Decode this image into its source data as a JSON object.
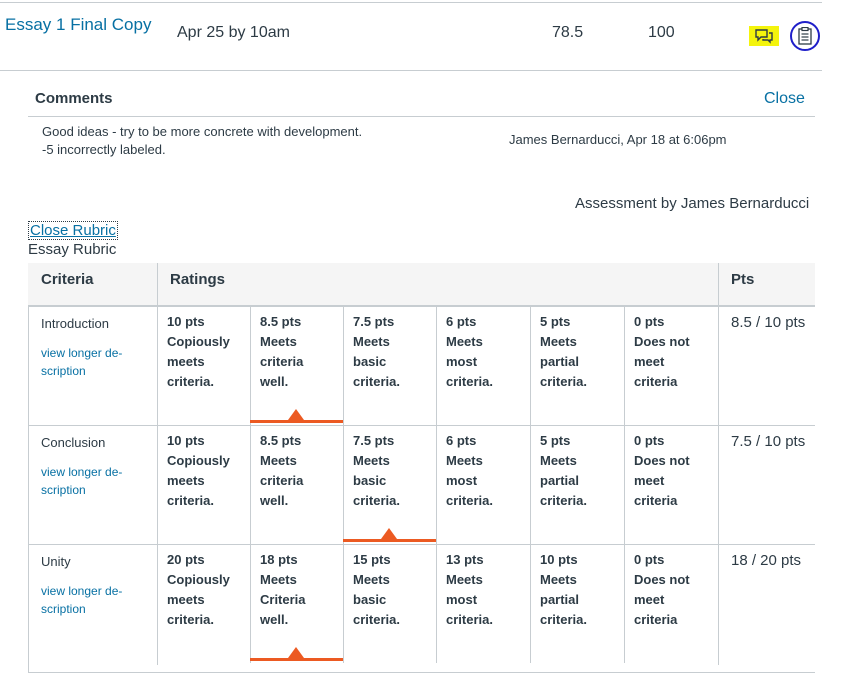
{
  "assignment": {
    "name": "Essay 1 Final Copy",
    "due": "Apr 25 by 10am",
    "score": "78.5",
    "points_possible": "100",
    "comment_icon": "comment-bubbles-icon",
    "rubric_icon": "rubric-clipboard-icon"
  },
  "comments": {
    "title": "Comments",
    "close_label": "Close",
    "lines": [
      "Good ideas - try to be more concrete with development.",
      "-5 incorrectly labeled."
    ],
    "author": "James Bernarducci, Apr 18 at 6:06pm"
  },
  "rubric": {
    "assessment_by": "Assessment by James Bernarducci",
    "close_label": "Close Rubric",
    "title": "Essay Rubric",
    "headers": {
      "criteria": "Criteria",
      "ratings": "Ratings",
      "pts": "Pts"
    },
    "highlight_color": "#ec5a22",
    "criteria": [
      {
        "name": "Introduction",
        "link": "view longer de-scription",
        "link_lines": [
          "view longer de-",
          "scription"
        ],
        "selected_index": 1,
        "score": "8.5 / 10 pts",
        "ratings": [
          {
            "pts": "10 pts",
            "desc": [
              "Copiously",
              "meets",
              "criteria."
            ]
          },
          {
            "pts": "8.5 pts",
            "desc": [
              "Meets",
              "criteria",
              "well."
            ]
          },
          {
            "pts": "7.5 pts",
            "desc": [
              "Meets",
              "basic",
              "criteria."
            ]
          },
          {
            "pts": "6 pts",
            "desc": [
              "Meets",
              "most",
              "criteria."
            ]
          },
          {
            "pts": "5 pts",
            "desc": [
              "Meets",
              "partial",
              "criteria."
            ]
          },
          {
            "pts": "0 pts",
            "desc": [
              "Does not",
              "meet",
              "criteria"
            ]
          }
        ]
      },
      {
        "name": "Conclusion",
        "link": "view longer de-scription",
        "link_lines": [
          "view longer de-",
          "scription"
        ],
        "selected_index": 2,
        "score": "7.5 / 10 pts",
        "ratings": [
          {
            "pts": "10 pts",
            "desc": [
              "Copiously",
              "meets",
              "criteria."
            ]
          },
          {
            "pts": "8.5 pts",
            "desc": [
              "Meets",
              "criteria",
              "well."
            ]
          },
          {
            "pts": "7.5 pts",
            "desc": [
              "Meets",
              "basic",
              "criteria."
            ]
          },
          {
            "pts": "6 pts",
            "desc": [
              "Meets",
              "most",
              "criteria."
            ]
          },
          {
            "pts": "5 pts",
            "desc": [
              "Meets",
              "partial",
              "criteria."
            ]
          },
          {
            "pts": "0 pts",
            "desc": [
              "Does not",
              "meet",
              "criteria"
            ]
          }
        ]
      },
      {
        "name": "Unity",
        "link": "view longer de-scription",
        "link_lines": [
          "view longer de-",
          "scription"
        ],
        "selected_index": 1,
        "score": "18 / 20 pts",
        "ratings": [
          {
            "pts": "20 pts",
            "desc": [
              "Copiously",
              "meets",
              "criteria."
            ]
          },
          {
            "pts": "18 pts",
            "desc": [
              "Meets",
              "Criteria",
              "well."
            ]
          },
          {
            "pts": "15 pts",
            "desc": [
              "Meets",
              "basic",
              "criteria."
            ]
          },
          {
            "pts": "13 pts",
            "desc": [
              "Meets",
              "most",
              "criteria."
            ]
          },
          {
            "pts": "10 pts",
            "desc": [
              "Meets",
              "partial",
              "criteria."
            ]
          },
          {
            "pts": "0 pts",
            "desc": [
              "Does not",
              "meet",
              "criteria"
            ]
          }
        ]
      }
    ]
  }
}
